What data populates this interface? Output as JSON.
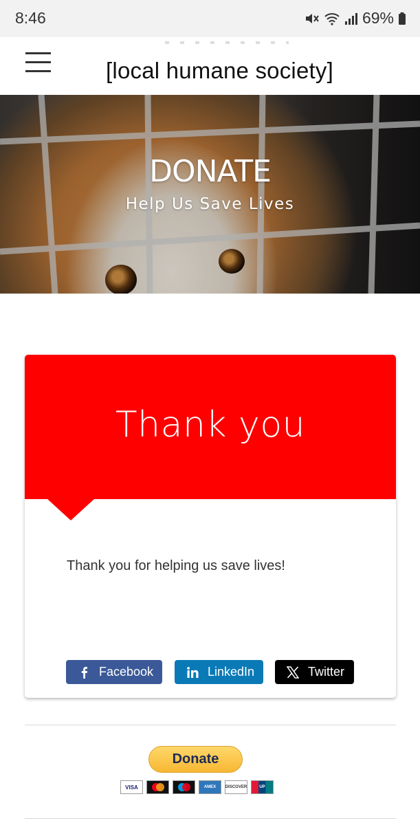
{
  "status_bar": {
    "time": "8:46",
    "battery_percent": "69%",
    "icons": [
      "mute-icon",
      "wifi-icon",
      "signal-icon",
      "battery-icon"
    ]
  },
  "header": {
    "site_title": "[local humane society]",
    "menu_icon": "hamburger-menu-icon"
  },
  "hero": {
    "title": "DONATE",
    "subtitle": "Help Us Save Lives"
  },
  "card": {
    "title": "Thank you",
    "message": "Thank you for helping us save lives!",
    "accent_color": "#fe0000"
  },
  "share": {
    "facebook_label": "Facebook",
    "linkedin_label": "LinkedIn",
    "twitter_label": "Twitter",
    "facebook_color": "#3b5998",
    "linkedin_color": "#0a7ab7",
    "twitter_color": "#000000"
  },
  "paypal": {
    "donate_label": "Donate",
    "card_brands": [
      "VISA",
      "Mastercard",
      "Maestro",
      "American Express",
      "DISCOVER",
      "UnionPay"
    ]
  }
}
